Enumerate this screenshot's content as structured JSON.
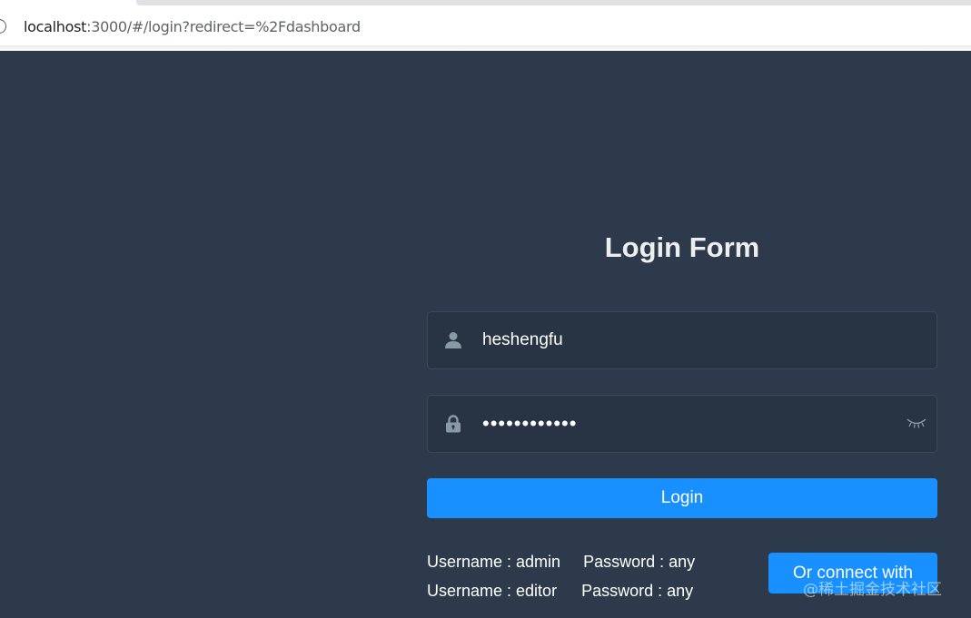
{
  "browser": {
    "url_host": "localhost",
    "url_rest": ":3000/#/login?redirect=%2Fdashboard"
  },
  "login": {
    "title": "Login Form",
    "username_value": "heshengfu",
    "password_value": "heshengfu123",
    "username_icon": "user-icon",
    "password_icon": "lock-icon",
    "eye_icon": "eye-closed-icon",
    "login_button": "Login",
    "tips": [
      {
        "username": "Username : admin",
        "password": "Password : any"
      },
      {
        "username": "Username : editor",
        "password": "Password : any"
      }
    ],
    "social_button": "Or connect with"
  },
  "watermark": "@稀土掘金技术社区",
  "colors": {
    "page_bg": "#2d3a4b",
    "input_bg": "#283443",
    "primary": "#1890ff",
    "title": "#eeeeee"
  }
}
